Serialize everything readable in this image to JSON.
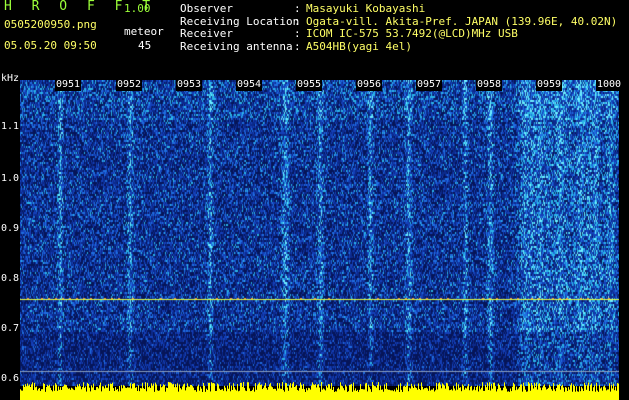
{
  "header": {
    "logo": "H R O F F T",
    "version": "1.00",
    "filename": "0505200950.png",
    "mode_label": "meteor",
    "datetime": "05.05.20 09:50",
    "count": "45"
  },
  "info": [
    {
      "key": "Observer",
      "value": "Masayuki Kobayashi"
    },
    {
      "key": "Receiving Location",
      "value": "Ogata-vill. Akita-Pref. JAPAN (139.96E, 40.02N)"
    },
    {
      "key": "Receiver",
      "value": "ICOM IC-575 53.7492(@LCD)MHz USB"
    },
    {
      "key": "Receiving antenna",
      "value": "A504HB(yagi 4el)"
    }
  ],
  "axis": {
    "unit": "kHz",
    "y_ticks": [
      "1.1",
      "1.0",
      "0.9",
      "0.8",
      "0.7",
      "0.6"
    ],
    "time_ticks": [
      "0951",
      "0952",
      "0953",
      "0954",
      "0955",
      "0956",
      "0957",
      "0958",
      "0959",
      "1000"
    ]
  },
  "colors": {
    "background": "#000000",
    "spectro_base": "#0a1f7a",
    "noise_mid": "#1a4fd0",
    "noise_high": "#28c8e8",
    "carrier": "#e8ff40",
    "amplitude": "#ffff00",
    "header_green": "#9cff3a",
    "header_yellow": "#ffff66"
  }
}
